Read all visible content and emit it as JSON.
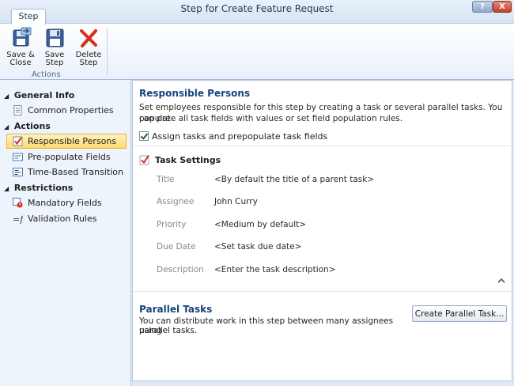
{
  "window": {
    "title": "Step for Create Feature Request",
    "help_label": "?",
    "close_label": "X"
  },
  "ribbon": {
    "tab_label": "Step",
    "buttons": {
      "save_close": "Save & Close",
      "save_step": "Save Step",
      "delete_step": "Delete Step"
    },
    "group_label": "Actions"
  },
  "nav": {
    "sections": [
      {
        "label": "General Info",
        "items": [
          {
            "label": "Common Properties",
            "icon": "document-icon"
          }
        ]
      },
      {
        "label": "Actions",
        "items": [
          {
            "label": "Responsible Persons",
            "icon": "task-check-icon",
            "selected": true
          },
          {
            "label": "Pre-populate Fields",
            "icon": "form-fields-icon"
          },
          {
            "label": "Time-Based Transition",
            "icon": "timer-transition-icon"
          }
        ]
      },
      {
        "label": "Restrictions",
        "items": [
          {
            "label": "Mandatory Fields",
            "icon": "mandatory-fields-icon"
          },
          {
            "label": "Validation Rules",
            "icon": "formula-icon"
          }
        ]
      }
    ]
  },
  "main": {
    "responsible": {
      "title": "Responsible Persons",
      "description_line1": "Set employees responsible for this step by creating a task or several parallel tasks. You can pre-",
      "description_line2": "populate all task fields with values or set field population rules.",
      "checkbox_label": "Assign tasks and prepopulate task fields",
      "checkbox_checked": true
    },
    "task_settings": {
      "title": "Task Settings",
      "fields": [
        {
          "label": "Title",
          "value": "<By default the title of a parent task>"
        },
        {
          "label": "Assignee",
          "value": "John Curry"
        },
        {
          "label": "Priority",
          "value": "<Medium by default>"
        },
        {
          "label": "Due Date",
          "value": "<Set task due date>"
        },
        {
          "label": "Description",
          "value": "<Enter the task description>"
        }
      ]
    },
    "parallel": {
      "title": "Parallel Tasks",
      "description_line1": "You can distribute work in this step between many assignees using",
      "description_line2": "parallel tasks.",
      "button_label": "Create Parallel Task..."
    }
  },
  "colors": {
    "heading_blue": "#16437e",
    "selection_yellow": "#ffd96b",
    "close_red": "#c4402a"
  }
}
